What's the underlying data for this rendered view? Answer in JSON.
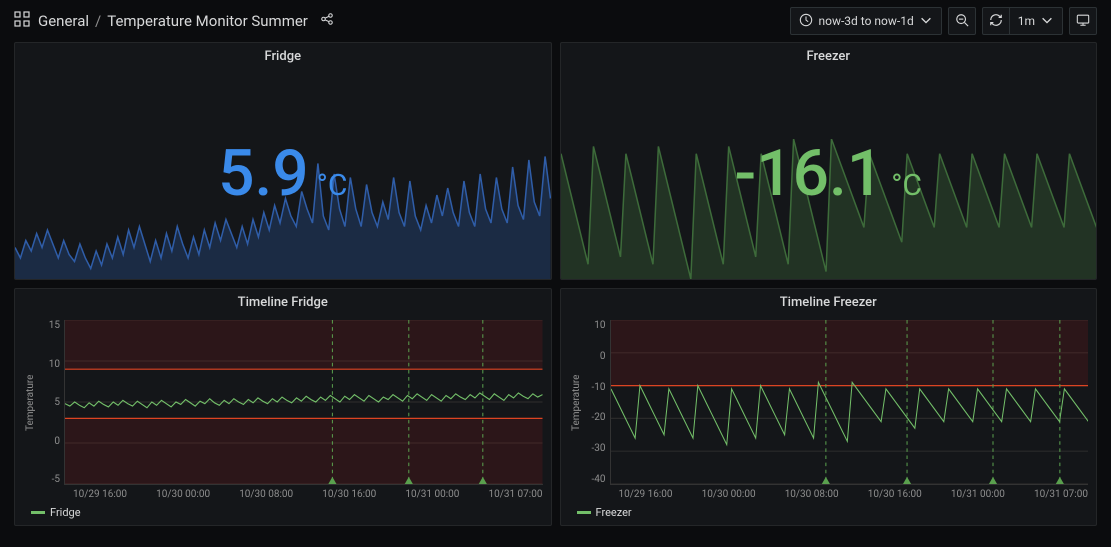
{
  "header": {
    "breadcrumb_root": "General",
    "breadcrumb_page": "Temperature Monitor Summer",
    "time_range": "now-3d to now-1d",
    "refresh_interval": "1m"
  },
  "panels": {
    "fridge_stat": {
      "title": "Fridge",
      "value": "5.9",
      "unit": "°C",
      "color": "#3a8aea"
    },
    "freezer_stat": {
      "title": "Freezer",
      "value": "-16.1",
      "unit": "°C",
      "color": "#73bf69"
    },
    "fridge_timeline": {
      "title": "Timeline Fridge",
      "ylabel": "Temperature",
      "legend": "Fridge"
    },
    "freezer_timeline": {
      "title": "Timeline Freezer",
      "ylabel": "Temperature",
      "legend": "Freezer"
    }
  },
  "chart_data": [
    {
      "id": "fridge_stat_spark",
      "type": "area",
      "title": "Fridge",
      "current_value": 5.9,
      "unit": "°C",
      "y_approx_range": [
        3.5,
        7.5
      ],
      "values": [
        4.4,
        4.1,
        4.6,
        4.3,
        4.8,
        4.4,
        4.9,
        4.5,
        4.1,
        4.6,
        4.2,
        4.0,
        4.5,
        4.1,
        3.8,
        4.3,
        3.9,
        4.5,
        4.1,
        4.7,
        4.2,
        4.9,
        4.4,
        5.0,
        4.5,
        4.0,
        4.6,
        4.1,
        4.8,
        4.3,
        5.0,
        4.5,
        4.1,
        4.7,
        4.2,
        4.9,
        4.4,
        5.1,
        4.6,
        5.2,
        4.8,
        4.4,
        5.0,
        4.5,
        5.2,
        4.7,
        5.4,
        4.9,
        5.6,
        5.1,
        5.8,
        5.3,
        5.0,
        6.0,
        5.5,
        5.1,
        6.8,
        5.3,
        4.9,
        6.5,
        5.5,
        5.0,
        6.4,
        5.5,
        5.0,
        6.2,
        5.4,
        5.0,
        5.7,
        5.2,
        6.4,
        5.4,
        5.0,
        6.3,
        5.3,
        4.9,
        5.6,
        5.1,
        5.9,
        5.3,
        6.1,
        5.4,
        5.0,
        6.3,
        5.4,
        5.0,
        6.5,
        5.5,
        5.1,
        6.4,
        5.5,
        5.1,
        6.7,
        5.6,
        5.2,
        6.9,
        5.7,
        5.3,
        7.0,
        5.8
      ]
    },
    {
      "id": "freezer_stat_spark",
      "type": "area",
      "title": "Freezer",
      "current_value": -16.1,
      "unit": "°C",
      "y_approx_range": [
        -28,
        -9
      ],
      "values": [
        -11,
        -14,
        -17,
        -20,
        -23,
        -26,
        -10,
        -13,
        -16,
        -19,
        -22,
        -25,
        -11,
        -14,
        -17,
        -20,
        -23,
        -26,
        -10,
        -13,
        -16,
        -19,
        -22,
        -25,
        -28,
        -11,
        -14,
        -17,
        -20,
        -23,
        -26,
        -10,
        -13,
        -16,
        -19,
        -22,
        -25,
        -11,
        -14,
        -17,
        -20,
        -23,
        -26,
        -9,
        -12,
        -15,
        -18,
        -21,
        -24,
        -27,
        -9,
        -11,
        -13,
        -15,
        -17,
        -19,
        -21,
        -11,
        -13,
        -15,
        -17,
        -19,
        -21,
        -23,
        -11,
        -13,
        -15,
        -17,
        -19,
        -21,
        -11,
        -13,
        -15,
        -17,
        -19,
        -21,
        -11,
        -13,
        -15,
        -17,
        -19,
        -21,
        -11,
        -13,
        -15,
        -17,
        -19,
        -21,
        -11,
        -13,
        -15,
        -17,
        -19,
        -21,
        -11,
        -13,
        -15,
        -17,
        -19,
        -21
      ]
    },
    {
      "id": "timeline_fridge",
      "type": "line",
      "title": "Timeline Fridge",
      "ylabel": "Temperature",
      "ylim": [
        -5,
        15
      ],
      "yticks": [
        -5,
        0,
        5,
        10,
        15
      ],
      "x_categories": [
        "10/29 16:00",
        "10/30 00:00",
        "10/30 08:00",
        "10/30 16:00",
        "10/31 00:00",
        "10/31 07:00"
      ],
      "thresholds": [
        {
          "value": 9,
          "color": "#c00",
          "fill_above_to": 15
        },
        {
          "value": 3,
          "color": "#c00",
          "fill_below_to": -5
        }
      ],
      "annotations_x_fraction": [
        0.56,
        0.72,
        0.875
      ],
      "series": [
        {
          "name": "Fridge",
          "color": "#73bf69",
          "values": [
            4.8,
            4.5,
            5.0,
            4.6,
            4.3,
            4.9,
            4.5,
            5.1,
            4.7,
            4.4,
            5.0,
            4.6,
            5.2,
            4.8,
            4.5,
            5.1,
            4.7,
            4.3,
            5.0,
            4.6,
            5.2,
            4.8,
            4.4,
            5.0,
            4.7,
            5.3,
            4.9,
            4.5,
            5.1,
            4.8,
            5.4,
            4.9,
            4.6,
            5.2,
            4.8,
            5.4,
            5.0,
            4.7,
            5.3,
            4.9,
            5.5,
            5.1,
            4.8,
            5.4,
            5.0,
            5.6,
            5.2,
            4.9,
            5.5,
            5.1,
            5.7,
            5.3,
            5.0,
            5.6,
            5.2,
            5.8,
            5.4,
            5.0,
            5.7,
            5.3,
            5.9,
            5.5,
            5.1,
            5.8,
            5.4,
            5.0,
            5.6,
            5.3,
            5.9,
            5.5,
            5.1,
            5.8,
            5.4,
            6.0,
            5.6,
            5.2,
            5.9,
            5.5,
            5.1,
            5.8,
            5.4,
            6.0,
            5.6,
            5.3,
            5.9,
            5.5,
            6.1,
            5.7,
            5.3,
            6.0,
            5.6,
            5.2,
            5.9,
            5.5,
            6.1,
            5.7,
            5.4,
            6.0,
            5.6,
            5.9
          ]
        }
      ]
    },
    {
      "id": "timeline_freezer",
      "type": "line",
      "title": "Timeline Freezer",
      "ylabel": "Temperature",
      "ylim": [
        -40,
        10
      ],
      "yticks": [
        -40,
        -30,
        -20,
        -10,
        0,
        10
      ],
      "x_categories": [
        "10/29 16:00",
        "10/30 00:00",
        "10/30 08:00",
        "10/30 16:00",
        "10/31 00:00",
        "10/31 07:00"
      ],
      "thresholds": [
        {
          "value": -10,
          "color": "#c00",
          "fill_above_to": 10
        }
      ],
      "annotations_x_fraction": [
        0.45,
        0.62,
        0.8,
        0.94
      ],
      "series": [
        {
          "name": "Freezer",
          "color": "#73bf69",
          "values": [
            -11,
            -14,
            -17,
            -20,
            -23,
            -26,
            -10,
            -13,
            -16,
            -19,
            -22,
            -25,
            -11,
            -14,
            -17,
            -20,
            -23,
            -26,
            -10,
            -13,
            -16,
            -19,
            -22,
            -25,
            -28,
            -11,
            -14,
            -17,
            -20,
            -23,
            -26,
            -10,
            -13,
            -16,
            -19,
            -22,
            -25,
            -11,
            -14,
            -17,
            -20,
            -23,
            -26,
            -9,
            -12,
            -15,
            -18,
            -21,
            -24,
            -27,
            -9,
            -11,
            -13,
            -15,
            -17,
            -19,
            -21,
            -11,
            -13,
            -15,
            -17,
            -19,
            -21,
            -23,
            -11,
            -13,
            -15,
            -17,
            -19,
            -21,
            -11,
            -13,
            -15,
            -17,
            -19,
            -21,
            -11,
            -13,
            -15,
            -17,
            -19,
            -21,
            -11,
            -13,
            -15,
            -17,
            -19,
            -21,
            -11,
            -13,
            -15,
            -17,
            -19,
            -21,
            -11,
            -13,
            -15,
            -17,
            -19,
            -21
          ]
        }
      ]
    }
  ]
}
